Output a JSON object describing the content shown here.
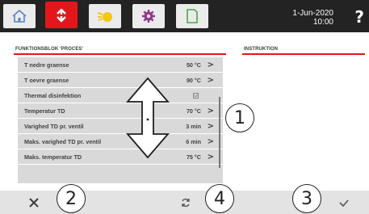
{
  "top_bar": {
    "tabs": [
      {
        "icon": "home-icon",
        "active": false
      },
      {
        "icon": "exchange-icon",
        "active": true
      },
      {
        "icon": "sun-icon",
        "active": false
      },
      {
        "icon": "gear-icon",
        "active": false
      },
      {
        "icon": "document-icon",
        "active": false
      }
    ],
    "date": "1-Jun-2020",
    "time": "10:00",
    "help_label": "?",
    "accent_color": "#e3161c"
  },
  "sections": {
    "left_title": "FUNKTIONSBLOK 'PROCES'",
    "right_title": "INSTRUKTION"
  },
  "menu": {
    "items": [
      {
        "label": "T nedre graense",
        "value": "50 °C",
        "type": "value"
      },
      {
        "label": "T oevre graense",
        "value": "90 °C",
        "type": "value"
      },
      {
        "label": "Thermal disinfektion",
        "value": "",
        "type": "checkbox",
        "checked": true
      },
      {
        "label": "Temperatur TD",
        "value": "70 °C",
        "type": "value"
      },
      {
        "label": "Varighed TD pr. ventil",
        "value": "3 min",
        "type": "value"
      },
      {
        "label": "Maks. varighed TD pr. ventil",
        "value": "6 min",
        "type": "value"
      },
      {
        "label": "Maks. temperatur TD",
        "value": "75 °C",
        "type": "value"
      }
    ],
    "chevron": ">"
  },
  "callouts": {
    "c1": "1",
    "c2": "2",
    "c3": "3",
    "c4": "4"
  },
  "bottom_bar": {
    "cancel_icon": "close-icon",
    "refresh_icon": "refresh-icon",
    "confirm_icon": "check-icon"
  }
}
